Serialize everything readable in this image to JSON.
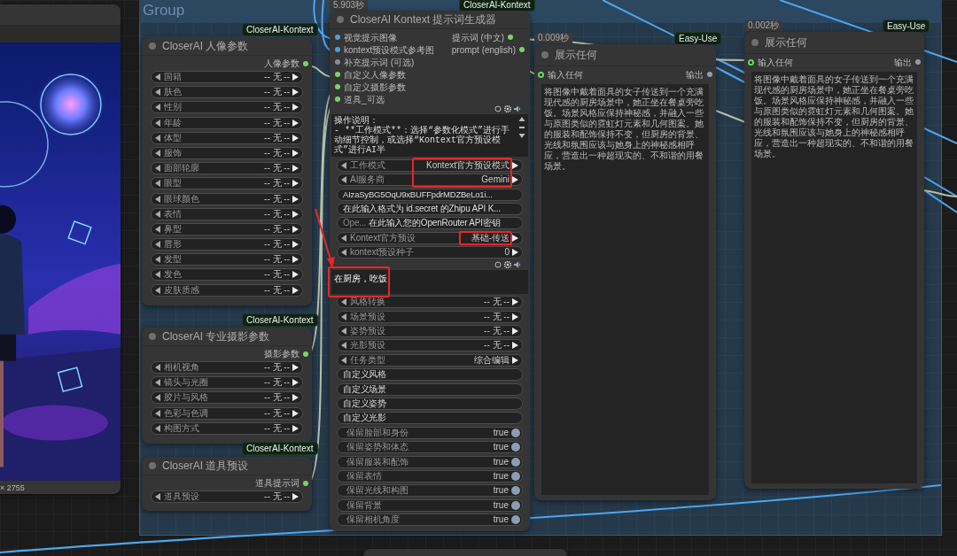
{
  "group": {
    "title": "Group"
  },
  "image_node": {
    "caption": "× 2755"
  },
  "portrait_node": {
    "badge": "CloserAI-Kontext",
    "title": "CloserAI 人像参数",
    "output": "人像参数",
    "combos": [
      {
        "label": "国籍",
        "value": "-- 无 --"
      },
      {
        "label": "肤色",
        "value": "-- 无 --"
      },
      {
        "label": "性别",
        "value": "-- 无 --"
      },
      {
        "label": "年龄",
        "value": "-- 无 --"
      },
      {
        "label": "体型",
        "value": "-- 无 --"
      },
      {
        "label": "服饰",
        "value": "-- 无 --"
      },
      {
        "label": "面部轮廓",
        "value": "-- 无 --"
      },
      {
        "label": "眼型",
        "value": "-- 无 --"
      },
      {
        "label": "眼球颜色",
        "value": "-- 无 --"
      },
      {
        "label": "表情",
        "value": "-- 无 --"
      },
      {
        "label": "鼻型",
        "value": "-- 无 --"
      },
      {
        "label": "唇形",
        "value": "-- 无 --"
      },
      {
        "label": "发型",
        "value": "-- 无 --"
      },
      {
        "label": "发色",
        "value": "-- 无 --"
      },
      {
        "label": "皮肤质感",
        "value": "-- 无 --"
      }
    ]
  },
  "photo_node": {
    "badge": "CloserAI-Kontext",
    "title": "CloserAI 专业摄影参数",
    "output": "摄影参数",
    "combos": [
      {
        "label": "相机视角",
        "value": "-- 无 --"
      },
      {
        "label": "镜头与光圈",
        "value": "-- 无 --"
      },
      {
        "label": "胶片与风格",
        "value": "-- 无 --"
      },
      {
        "label": "色彩与色调",
        "value": "-- 无 --"
      },
      {
        "label": "构图方式",
        "value": "-- 无 --"
      }
    ]
  },
  "props_node": {
    "badge": "CloserAI-Kontext",
    "title": "CloserAI 道具预设",
    "output": "道具提示词",
    "combos": [
      {
        "label": "道具预设",
        "value": "-- 无 --"
      }
    ]
  },
  "generator_node": {
    "timing": "5.903秒",
    "badge": "CloserAI-Kontext",
    "title": "CloserAI Kontext 提示词生成器",
    "inputs": [
      {
        "label": "视觉提示图像",
        "color": "#4a9fe0"
      },
      {
        "label": "kontext预设模式参考图",
        "color": "#4a9fe0"
      },
      {
        "label": "补充提示词 (可选)",
        "color": "#8a8aa0"
      },
      {
        "label": "自定义人像参数",
        "color": "#7ad36a"
      },
      {
        "label": "自定义摄影参数",
        "color": "#7ad36a"
      },
      {
        "label": "道具_可选",
        "color": "#7ad36a"
      }
    ],
    "outputs": [
      {
        "label": "提示词 (中文)"
      },
      {
        "label": "prompt (english)"
      }
    ],
    "widgets": [
      {
        "kind": "notes",
        "lines": [
          "操作说明：",
          "- **工作模式**：选择“参数化模式”进行手动细节控制，或选择“Kontext官方预设模式”进行AI半"
        ]
      },
      {
        "kind": "combo",
        "label": "工作模式",
        "value": "Kontext官方预设模式",
        "highlighted": true
      },
      {
        "kind": "combo",
        "label": "AI服务商",
        "value": "Gemini",
        "highlighted": true
      },
      {
        "kind": "text",
        "value": "AIzaSyBG5OqU9xBUFFpdrMDZBeLo1i..."
      },
      {
        "kind": "text",
        "value": "在此输入格式为 id.secret 的Zhipu API K..."
      },
      {
        "kind": "text",
        "label": "Ope...",
        "value": "在此输入您的OpenRouter API密钥"
      },
      {
        "kind": "combo",
        "label": "Kontext官方预设",
        "value": "基础-传送",
        "highlighted": true
      },
      {
        "kind": "number",
        "label": "kontext预设种子",
        "value": "0"
      },
      {
        "kind": "prompt",
        "value": "在厨房，吃饭",
        "highlighted": true
      },
      {
        "kind": "combo",
        "label": "风格转换",
        "value": "-- 无 --"
      },
      {
        "kind": "combo",
        "label": "场景预设",
        "value": "-- 无 --"
      },
      {
        "kind": "combo",
        "label": "姿势预设",
        "value": "-- 无 --"
      },
      {
        "kind": "combo",
        "label": "光影预设",
        "value": "-- 无 --"
      },
      {
        "kind": "combo",
        "label": "任务类型",
        "value": "综合编辑"
      },
      {
        "kind": "text",
        "value": "自定义风格"
      },
      {
        "kind": "text",
        "value": "自定义场景"
      },
      {
        "kind": "text",
        "value": "自定义姿势"
      },
      {
        "kind": "text",
        "value": "自定义光影"
      },
      {
        "kind": "toggle",
        "label": "保留脸部和身份",
        "value": "true",
        "on": true
      },
      {
        "kind": "toggle",
        "label": "保留姿势和体态",
        "value": "true",
        "on": true
      },
      {
        "kind": "toggle",
        "label": "保留服装和配饰",
        "value": "true",
        "on": true
      },
      {
        "kind": "toggle",
        "label": "保留表情",
        "value": "true",
        "on": true
      },
      {
        "kind": "toggle",
        "label": "保留光线和构图",
        "value": "true",
        "on": true
      },
      {
        "kind": "toggle",
        "label": "保留背景",
        "value": "true",
        "on": true
      },
      {
        "kind": "toggle",
        "label": "保留相机角度",
        "value": "true",
        "on": true
      }
    ]
  },
  "display_nodes": [
    {
      "timing": "0.009秒",
      "badge": "Easy-Use",
      "title": "展示任何",
      "input": "输入任何",
      "output": "输出",
      "text": "将图像中戴着面具的女子传送到一个充满现代感的厨房场景中，她正坐在餐桌旁吃饭。场景风格应保持神秘感，并融入一些与原图类似的霓虹灯元素和几何图案。她的服装和配饰保持不变，但厨房的背景、光线和氛围应该与她身上的神秘感相呼应，营造出一种超现实的、不和谐的用餐场景。"
    },
    {
      "timing": "0.002秒",
      "badge": "Easy-Use",
      "title": "展示任何",
      "input": "输入任何",
      "output": "输出",
      "text": "将图像中戴着面具的女子传送到一个充满现代感的厨房场景中，她正坐在餐桌旁吃饭。场景风格应保持神秘感，并融入一些与原图类似的霓虹灯元素和几何图案。她的服装和配饰保持不变，但厨房的背景、光线和氛围应该与她身上的神秘感相呼应，营造出一种超现实的、不和谐的用餐场景。"
    }
  ]
}
